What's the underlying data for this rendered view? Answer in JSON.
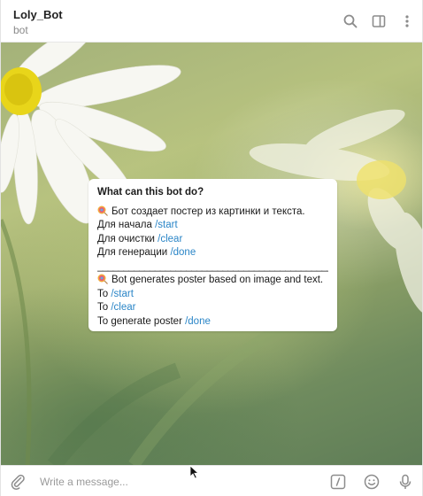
{
  "header": {
    "title": "Loly_Bot",
    "subtitle": "bot",
    "icons": [
      "search-icon",
      "sidebar-icon",
      "more-vertical-icon"
    ]
  },
  "info_card": {
    "title": "What can this bot do?",
    "ru": {
      "intro": "Бот создает постер из картинки и текста.",
      "line_start_prefix": "Для начала ",
      "line_start_cmd": "/start",
      "line_clear_prefix": "Для очистки ",
      "line_clear_cmd": "/clear",
      "line_done_prefix": "Для генерации ",
      "line_done_cmd": "/done"
    },
    "separator": "________________________________________________",
    "en": {
      "intro": "Bot generates poster based on image and text.",
      "line_start_prefix": "To ",
      "line_start_cmd": "/start",
      "line_clear_prefix": "To ",
      "line_clear_cmd": "/clear",
      "line_done_prefix": "To generate poster ",
      "line_done_cmd": "/done"
    },
    "emoji_icon": "lollipop-icon"
  },
  "composer": {
    "placeholder": "Write a message...",
    "icons": [
      "paperclip-icon",
      "bot-commands-icon",
      "emoji-icon",
      "microphone-icon"
    ]
  },
  "colors": {
    "link": "#2a85c7",
    "icon": "#8c8c8c",
    "card_bg": "#ffffff"
  }
}
